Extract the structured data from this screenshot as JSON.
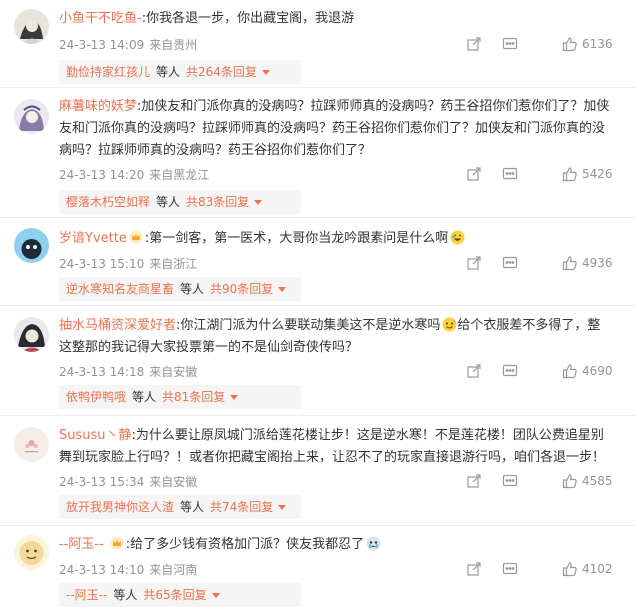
{
  "comments": [
    {
      "name": "小鱼干不吃鱼-",
      "text": ":你我各退一步，你出藏宝阁，我退游",
      "text_lines": [],
      "date": "24-3-13 14:09",
      "location": "来自贵州",
      "likes": "6136",
      "reply_name": "勤俭持家红孩儿",
      "reply_mid": "等人",
      "reply_count": "共264条回复"
    },
    {
      "name": "麻薯味的妖梦",
      "text": ":加侠友和门派你真的没病吗？拉踩师师真的没病吗？药王谷招你们惹你们了？加侠",
      "text_lines": [
        "友和门派你真的没病吗？拉踩师师真的没病吗？药王谷招你们惹你们了？加侠友和门派你真的没",
        "病吗？拉踩师师真的没病吗？药王谷招你们惹你们了？"
      ],
      "date": "24-3-13 14:20",
      "location": "来自黑龙江",
      "likes": "5426",
      "reply_name": "樱落木朽空如释",
      "reply_mid": "等人",
      "reply_count": "共83条回复"
    },
    {
      "name": "岁谙Yvette",
      "text": ":第一剑客，第一医术，大哥你当龙吟跟素问是什么啊",
      "text_lines": [],
      "date": "24-3-13 15:10",
      "location": "来自浙江",
      "likes": "4936",
      "reply_name": "逆水寒知名友商星畜",
      "reply_mid": "等人",
      "reply_count": "共90条回复"
    },
    {
      "name": "抽水马桶资深爱好者",
      "text": ":你江湖门派为什么要联动集美这不是逆水寒吗",
      "text_b": "给个衣服差不多得了，整",
      "text_lines": [
        "这整那的我记得大家投票第一的不是仙剑奇侠传吗？"
      ],
      "date": "24-3-13 14:18",
      "location": "来自安徽",
      "likes": "4690",
      "reply_name": "依鸭伊鸭哦",
      "reply_mid": "等人",
      "reply_count": "共81条回复"
    },
    {
      "name": "Sususu丶静",
      "text": ":为什么要让原凤城门派给莲花楼让步！这是逆水寒！不是莲花楼！团队公费追星别",
      "text_lines": [
        "舞到玩家脸上行吗？！或者你把藏宝阁抬上来，让忍不了的玩家直接退游行吗，咱们各退一步！"
      ],
      "date": "24-3-13 15:34",
      "location": "来自安徽",
      "likes": "4585",
      "reply_name": "放开我男神你这人渣",
      "reply_mid": "等人",
      "reply_count": "共74条回复"
    },
    {
      "name": "--阿玉--",
      "text": ":给了多少钱有资格加门派？侠友我都忍了",
      "text_lines": [],
      "date": "24-3-13 14:10",
      "location": "来自河南",
      "likes": "4102",
      "reply_name": "--阿玉--",
      "reply_mid": "等人",
      "reply_count": "共65条回复"
    }
  ],
  "icons": {
    "share": "share-icon",
    "comment": "comment-icon",
    "like": "thumbs-up-icon",
    "caret": "caret-down-icon"
  },
  "colors": {
    "name": "#eb7350",
    "text": "#333333",
    "meta": "#939393",
    "reply_bg": "#f5f5f5",
    "divider": "#eeeeee"
  }
}
